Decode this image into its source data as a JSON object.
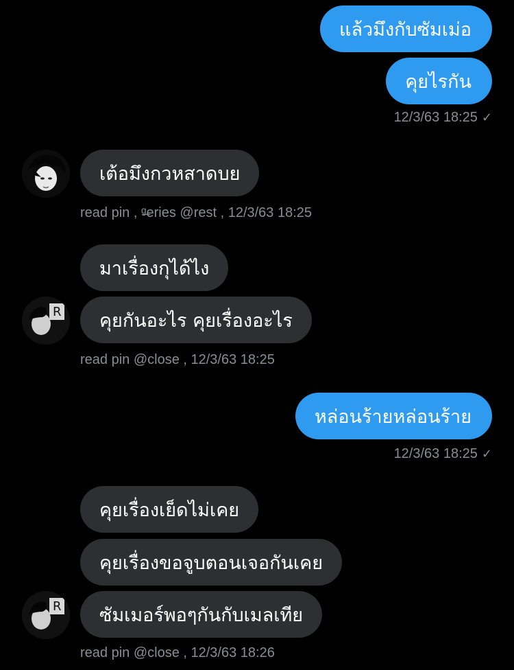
{
  "messages": [
    {
      "side": "out",
      "text": "แล้วมึงกับซัมเม่อ"
    },
    {
      "side": "out",
      "text": "คุยไรกัน"
    },
    {
      "side": "meta_out",
      "text": "12/3/63 18:25"
    },
    {
      "side": "in",
      "text": "เต้อมึงกวหสาดบย"
    },
    {
      "side": "meta_in",
      "text": "read pin , ᵍ̶eries @rest  , 12/3/63 18:25"
    },
    {
      "side": "in",
      "text": "มาเรื่องกุได้ไง"
    },
    {
      "side": "in",
      "text": "คุยกันอะไร คุยเรื่องอะไร"
    },
    {
      "side": "meta_in",
      "text": "read pin @close  , 12/3/63 18:25"
    },
    {
      "side": "out",
      "text": "หล่อนร้ายหล่อนร้าย"
    },
    {
      "side": "meta_out",
      "text": "12/3/63 18:25"
    },
    {
      "side": "in",
      "text": "คุยเรื่องเย็ดไม่เคย"
    },
    {
      "side": "in",
      "text": "คุยเรื่องขอจูบตอนเจอกันเคย"
    },
    {
      "side": "in",
      "text": "ซัมเมอร์พอๆกันกับเมลเทีย"
    },
    {
      "side": "meta_in",
      "text": "read pin @close  , 12/3/63 18:26"
    }
  ],
  "icons": {
    "read_check": "✓",
    "avatar_1": "avatar-dark-hair",
    "avatar_2": "avatar-bw-photo",
    "avatar_3": "avatar-bw-photo"
  },
  "colors": {
    "background": "#000000",
    "outgoing_bubble": "#2f9bf0",
    "incoming_bubble": "#2e2f33",
    "meta_text": "#8a8d93"
  }
}
